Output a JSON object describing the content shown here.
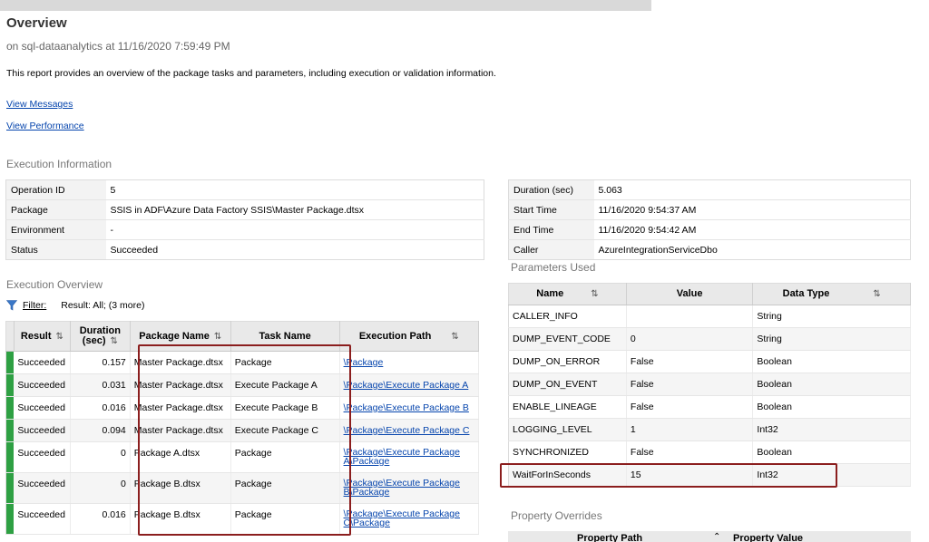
{
  "header": {
    "title": "Overview",
    "subtitle": "on sql-dataanalytics at 11/16/2020 7:59:49 PM",
    "description": "This report provides an overview of the package tasks and parameters, including execution or validation information.",
    "link_messages": "View Messages",
    "link_performance": "View Performance"
  },
  "execution_info": {
    "heading": "Execution Information",
    "left": [
      {
        "label": "Operation ID",
        "value": "5"
      },
      {
        "label": "Package",
        "value": "SSIS in ADF\\Azure Data Factory SSIS\\Master Package.dtsx"
      },
      {
        "label": "Environment",
        "value": "-"
      },
      {
        "label": "Status",
        "value": "Succeeded"
      }
    ],
    "right": [
      {
        "label": "Duration (sec)",
        "value": "5.063"
      },
      {
        "label": "Start Time",
        "value": "11/16/2020 9:54:37 AM"
      },
      {
        "label": "End Time",
        "value": "11/16/2020 9:54:42 AM"
      },
      {
        "label": "Caller",
        "value": "AzureIntegrationServiceDbo"
      }
    ]
  },
  "execution_overview": {
    "heading": "Execution Overview",
    "filter_label": "Filter:",
    "filter_value": "Result: All;  (3 more)",
    "columns": [
      "Result",
      "Duration (sec)",
      "Package Name",
      "Task Name",
      "Execution Path"
    ],
    "rows": [
      {
        "result": "Succeeded",
        "duration": "0.157",
        "package": "Master Package.dtsx",
        "task": "Package",
        "path": "\\Package"
      },
      {
        "result": "Succeeded",
        "duration": "0.031",
        "package": "Master Package.dtsx",
        "task": "Execute Package A",
        "path": "\\Package\\Execute Package A"
      },
      {
        "result": "Succeeded",
        "duration": "0.016",
        "package": "Master Package.dtsx",
        "task": "Execute Package B",
        "path": "\\Package\\Execute Package B"
      },
      {
        "result": "Succeeded",
        "duration": "0.094",
        "package": "Master Package.dtsx",
        "task": "Execute Package C",
        "path": "\\Package\\Execute Package C"
      },
      {
        "result": "Succeeded",
        "duration": "0",
        "package": "Package A.dtsx",
        "task": "Package",
        "path": "\\Package\\Execute Package A\\Package"
      },
      {
        "result": "Succeeded",
        "duration": "0",
        "package": "Package B.dtsx",
        "task": "Package",
        "path": "\\Package\\Execute Package B\\Package"
      },
      {
        "result": "Succeeded",
        "duration": "0.016",
        "package": "Package B.dtsx",
        "task": "Package",
        "path": "\\Package\\Execute Package C\\Package"
      }
    ]
  },
  "parameters": {
    "heading": "Parameters Used",
    "columns": [
      "Name",
      "Value",
      "Data Type"
    ],
    "rows": [
      {
        "name": "CALLER_INFO",
        "value": "",
        "type": "String"
      },
      {
        "name": "DUMP_EVENT_CODE",
        "value": "0",
        "type": "String"
      },
      {
        "name": "DUMP_ON_ERROR",
        "value": "False",
        "type": "Boolean"
      },
      {
        "name": "DUMP_ON_EVENT",
        "value": "False",
        "type": "Boolean"
      },
      {
        "name": "ENABLE_LINEAGE",
        "value": "False",
        "type": "Boolean"
      },
      {
        "name": "LOGGING_LEVEL",
        "value": "1",
        "type": "Int32"
      },
      {
        "name": "SYNCHRONIZED",
        "value": "False",
        "type": "Boolean"
      },
      {
        "name": "WaitForInSeconds",
        "value": "15",
        "type": "Int32"
      }
    ]
  },
  "property_overrides": {
    "heading": "Property Overrides",
    "columns": [
      "Property Path",
      "Property Value"
    ]
  },
  "colors": {
    "success": "#2ea043",
    "link": "#0645ad",
    "highlight": "#8b1e1e"
  }
}
